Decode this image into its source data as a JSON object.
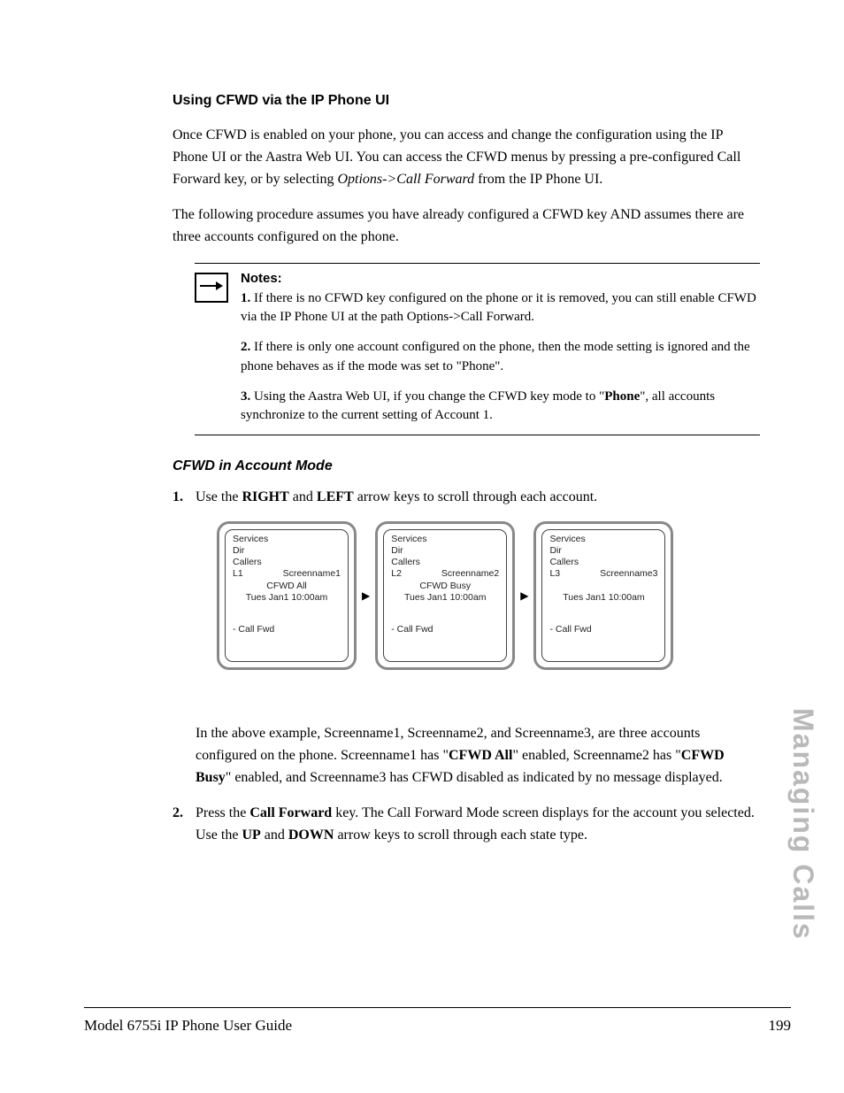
{
  "heading1": "Using CFWD via the IP Phone UI",
  "para1_a": "Once CFWD is enabled on your phone, you can access and change the configuration using the IP Phone UI or the Aastra Web UI. You can access the CFWD menus by pressing a pre-configured Call Forward key, or by selecting ",
  "para1_it": "Options->Call Forward",
  "para1_b": " from the IP Phone UI.",
  "para2": "The following procedure assumes you have already configured a CFWD key AND assumes there are three accounts configured on the phone.",
  "notes_title": "Notes:",
  "note1_num": "1.",
  "note1": "  If there is no CFWD key configured on the phone or it is removed, you can still enable CFWD via the IP Phone UI at the path Options->Call Forward.",
  "note2_num": "2.",
  "note2": "  If there is only one account configured on the phone, then the mode setting is ignored and the phone behaves as if the mode was set to \"Phone\".",
  "note3_num": "3.",
  "note3_a": "  Using the Aastra Web UI, if you change the CFWD key mode to \"",
  "note3_bold": "Phone",
  "note3_b": "\", all accounts synchronize to the current setting of Account 1.",
  "heading2": "CFWD in Account Mode",
  "step1_num": "1.",
  "step1_a": "Use the ",
  "step1_b1": "RIGHT",
  "step1_mid": " and ",
  "step1_b2": "LEFT",
  "step1_c": " arrow keys to scroll through each account.",
  "screens": [
    {
      "services": "Services",
      "dir": "Dir",
      "callers": "Callers",
      "line": "L1",
      "name": "Screenname1",
      "mode": "CFWD All",
      "date": "Tues Jan1 10:00am",
      "fwd": "- Call Fwd"
    },
    {
      "services": "Services",
      "dir": "Dir",
      "callers": "Callers",
      "line": "L2",
      "name": "Screenname2",
      "mode": "CFWD Busy",
      "date": "Tues Jan1 10:00am",
      "fwd": "- Call Fwd"
    },
    {
      "services": "Services",
      "dir": "Dir",
      "callers": "Callers",
      "line": "L3",
      "name": "Screenname3",
      "mode": "",
      "date": "Tues Jan1 10:00am",
      "fwd": "- Call Fwd"
    }
  ],
  "explain_a": "In the above example, Screenname1, Screenname2, and Screenname3, are three accounts configured on the phone. Screenname1 has \"",
  "explain_b1": "CFWD All",
  "explain_mid1": "\" enabled, Screenname2 has \"",
  "explain_b2": "CFWD Busy",
  "explain_mid2": "\" enabled, and Screenname3 has CFWD disabled as indicated by no message displayed.",
  "step2_num": "2.",
  "step2_a": "Press the ",
  "step2_b1": "Call Forward",
  "step2_mid1": " key. The Call Forward Mode screen displays for the account you selected. Use the ",
  "step2_b2": "UP",
  "step2_mid2": " and ",
  "step2_b3": "DOWN",
  "step2_c": " arrow keys to scroll through each state type.",
  "side_tab": "Managing Calls",
  "footer_left": "Model 6755i IP Phone User Guide",
  "footer_right": "199"
}
